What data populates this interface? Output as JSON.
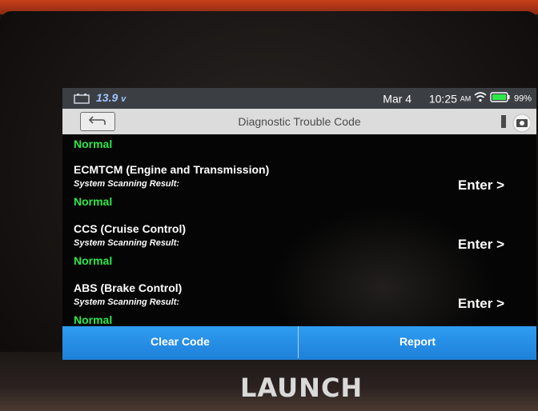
{
  "device": {
    "brand": "LAUNCH"
  },
  "status_bar": {
    "voltage": "13.9",
    "voltage_unit": "v",
    "date": "Mar 4",
    "time": "10:25",
    "ampm": "AM",
    "battery": "99%"
  },
  "title_bar": {
    "title": "Diagnostic Trouble Code"
  },
  "systems": [
    {
      "name": "",
      "sub": "",
      "result": "Normal",
      "enter": ""
    },
    {
      "name": "ECMTCM (Engine and Transmission)",
      "sub": "System Scanning Result:",
      "result": "Normal",
      "enter": "Enter >"
    },
    {
      "name": "CCS (Cruise Control)",
      "sub": "System Scanning Result:",
      "result": "Normal",
      "enter": "Enter >"
    },
    {
      "name": "ABS (Brake Control)",
      "sub": "System Scanning Result:",
      "result": "Normal",
      "enter": "Enter >"
    }
  ],
  "actions": {
    "clear_code": "Clear Code",
    "report": "Report"
  },
  "colors": {
    "accent": "#1e80d8",
    "normal_status": "#2ee84a",
    "status_bar": "#3b3f44"
  }
}
